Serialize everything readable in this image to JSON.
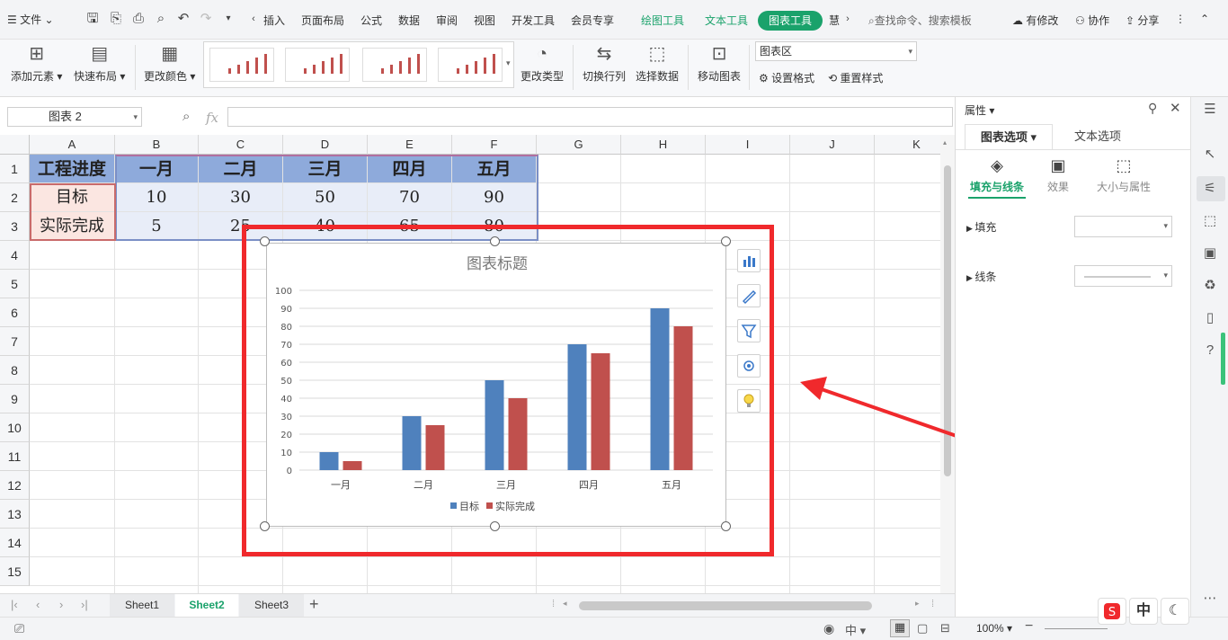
{
  "menubar": {
    "file_menu": "文件",
    "tabs": [
      "插入",
      "页面布局",
      "公式",
      "数据",
      "审阅",
      "视图",
      "开发工具",
      "会员专享"
    ],
    "context_tabs": [
      "绘图工具",
      "文本工具"
    ],
    "active_tab": "图表工具",
    "overflow_tab": "慧",
    "search_placeholder": "查找命令、搜索模板",
    "modify_label": "有修改",
    "collab_label": "协作",
    "share_label": "分享"
  },
  "ribbon": {
    "add_element": "添加元素",
    "quick_layout": "快速布局",
    "change_color": "更改颜色",
    "change_type": "更改类型",
    "switch_rowcol": "切换行列",
    "select_data": "选择数据",
    "move_chart": "移动图表",
    "element_select": "图表区",
    "set_format": "设置格式",
    "reset_style": "重置样式"
  },
  "formula_bar": {
    "name_box": "图表 2",
    "fx_label": "fx",
    "value": ""
  },
  "sheet": {
    "columns": [
      "A",
      "B",
      "C",
      "D",
      "E",
      "F",
      "G",
      "H",
      "I",
      "J",
      "K"
    ],
    "rows": [
      "1",
      "2",
      "3",
      "4",
      "5",
      "6",
      "7",
      "8",
      "9",
      "10",
      "11",
      "12",
      "13",
      "14",
      "15"
    ],
    "header_row": [
      "工程进度",
      "一月",
      "二月",
      "三月",
      "四月",
      "五月"
    ],
    "target_row": [
      "目标",
      "10",
      "30",
      "50",
      "70",
      "90"
    ],
    "actual_row": [
      "实际完成",
      "5",
      "25",
      "40",
      "65",
      "80"
    ]
  },
  "chart_data": {
    "type": "bar",
    "title": "图表标题",
    "categories": [
      "一月",
      "二月",
      "三月",
      "四月",
      "五月"
    ],
    "series": [
      {
        "name": "目标",
        "values": [
          10,
          30,
          50,
          70,
          90
        ],
        "color": "#4f81bd"
      },
      {
        "name": "实际完成",
        "values": [
          5,
          25,
          40,
          65,
          80
        ],
        "color": "#c0504d"
      }
    ],
    "ylim": [
      0,
      100
    ],
    "yticks": [
      "0",
      "10",
      "20",
      "30",
      "40",
      "50",
      "60",
      "70",
      "80",
      "90",
      "100"
    ],
    "grid": true,
    "legend": "bottom"
  },
  "sheet_tabs": {
    "tabs": [
      "Sheet1",
      "Sheet2",
      "Sheet3"
    ],
    "active": "Sheet2",
    "add": "+"
  },
  "panel": {
    "title": "属性",
    "tabs": [
      "图表选项",
      "文本选项"
    ],
    "subtabs": [
      "填充与线条",
      "效果",
      "大小与属性"
    ],
    "fill_label": "填充",
    "line_label": "线条"
  },
  "statusbar": {
    "zoom": "100%",
    "lang_badge": "中"
  },
  "colors": {
    "accent_green": "#1aa26b",
    "highlight_red": "#f0292c",
    "series_blue": "#4f81bd",
    "series_red": "#c0504d"
  }
}
